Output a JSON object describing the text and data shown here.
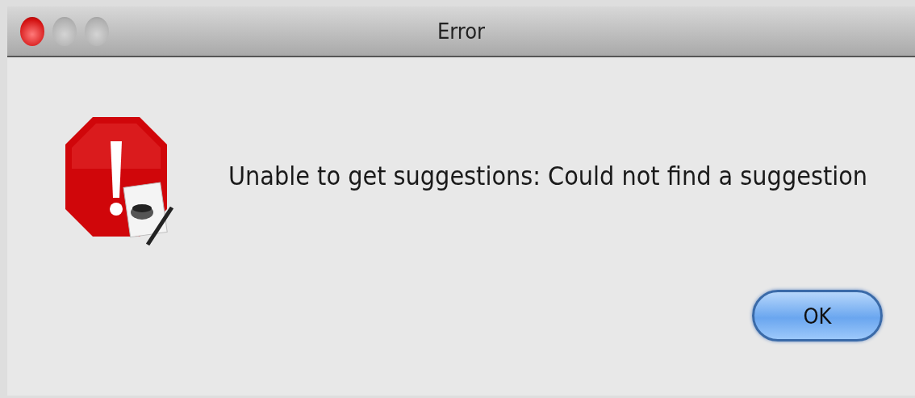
{
  "window": {
    "title": "Error"
  },
  "message": "Unable to get suggestions: Could not find a suggestion",
  "buttons": [
    {
      "label": "OK",
      "default": true
    }
  ]
}
